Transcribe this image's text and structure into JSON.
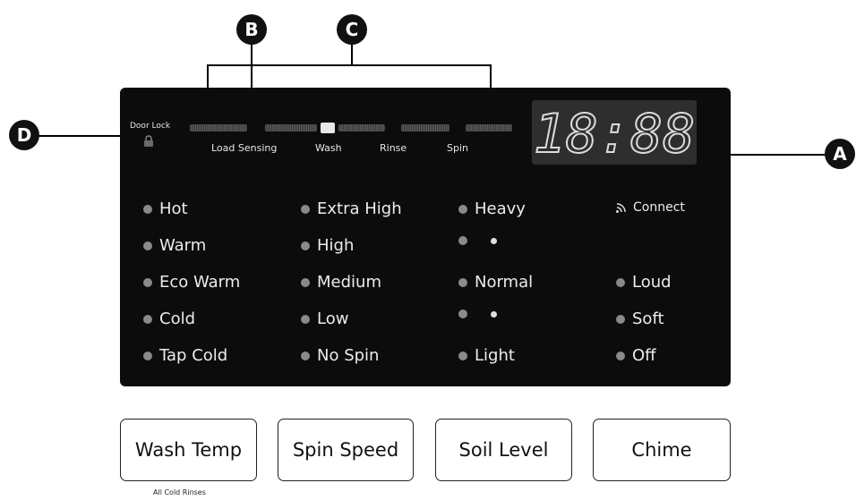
{
  "callouts": {
    "a": "A",
    "b": "B",
    "c": "C",
    "d": "D"
  },
  "status_bar": {
    "door_lock_label": "Door Lock",
    "stages": [
      "Load Sensing",
      "Wash",
      "Rinse",
      "Spin"
    ]
  },
  "time_display": {
    "value": "18:88"
  },
  "wash_temp_options": [
    "Hot",
    "Warm",
    "Eco Warm",
    "Cold",
    "Tap Cold"
  ],
  "spin_speed_options": [
    "Extra High",
    "High",
    "Medium",
    "Low",
    "No Spin"
  ],
  "soil_level_options": [
    "Heavy",
    "Normal",
    "Light"
  ],
  "connect_label": "Connect",
  "chime_options": [
    "Loud",
    "Soft",
    "Off"
  ],
  "buttons": {
    "wash_temp": "Wash Temp",
    "spin_speed": "Spin Speed",
    "soil_level": "Soil Level",
    "chime": "Chime"
  },
  "wash_temp_sublabel": "All Cold Rinses"
}
